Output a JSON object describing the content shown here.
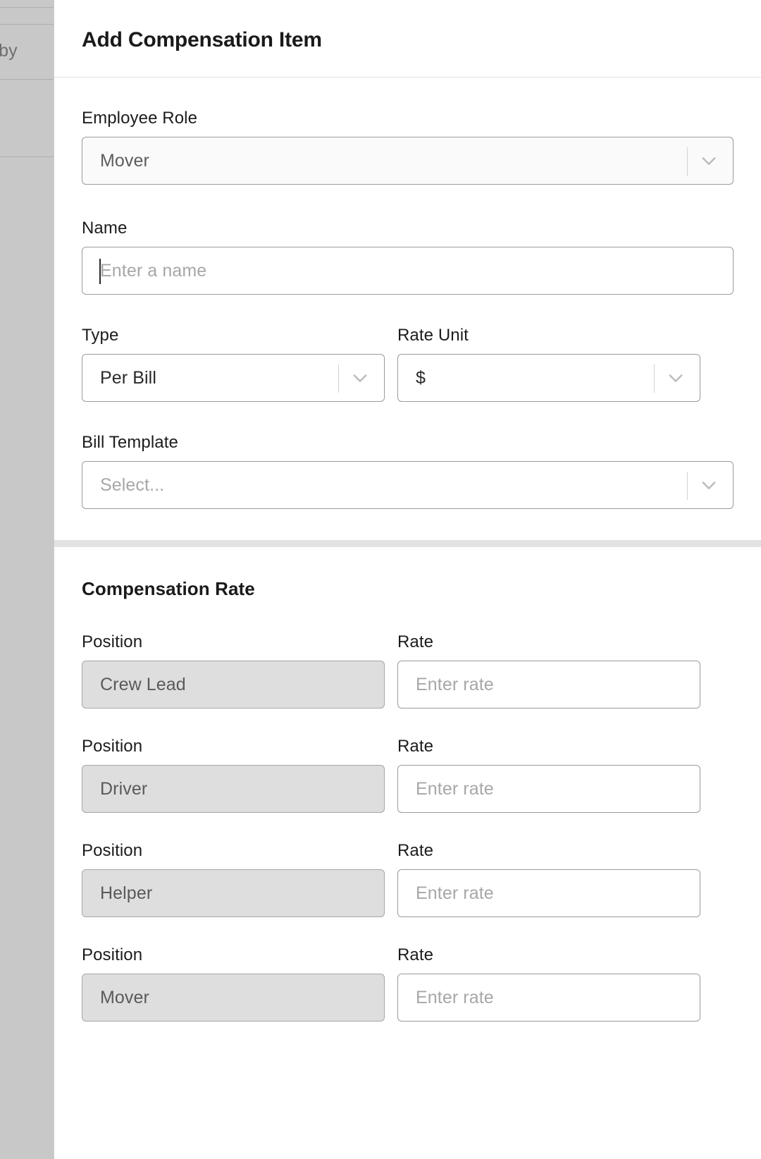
{
  "backdrop": {
    "search_fragment": "arch by"
  },
  "drawer": {
    "title": "Add Compensation Item",
    "form": {
      "employee_role": {
        "label": "Employee Role",
        "value": "Mover",
        "chevron_icon": "chevron-down-icon"
      },
      "name": {
        "label": "Name",
        "value": "",
        "placeholder": "Enter a name"
      },
      "type": {
        "label": "Type",
        "value": "Per Bill",
        "chevron_icon": "chevron-down-icon"
      },
      "rate_unit": {
        "label": "Rate Unit",
        "value": "$",
        "chevron_icon": "chevron-down-icon"
      },
      "bill_template": {
        "label": "Bill Template",
        "value": "",
        "placeholder": "Select...",
        "chevron_icon": "chevron-down-icon"
      }
    },
    "compensation_rate": {
      "heading": "Compensation Rate",
      "position_label": "Position",
      "rate_label": "Rate",
      "rate_placeholder": "Enter rate",
      "rows": [
        {
          "position": "Crew Lead",
          "rate": "",
          "position_label": "Position",
          "rate_label": "Rate",
          "rate_placeholder": "Enter rate"
        },
        {
          "position": "Driver",
          "rate": "",
          "position_label": "Position",
          "rate_label": "Rate",
          "rate_placeholder": "Enter rate"
        },
        {
          "position": "Helper",
          "rate": "",
          "position_label": "Position",
          "rate_label": "Rate",
          "rate_placeholder": "Enter rate"
        },
        {
          "position": "Mover",
          "rate": "",
          "position_label": "Position",
          "rate_label": "Rate",
          "rate_placeholder": "Enter rate"
        }
      ]
    }
  },
  "colors": {
    "panel_background": "#ffffff",
    "backdrop_scrim": "#c8c8c8",
    "text_primary": "#1a1a1a",
    "text_placeholder": "#a7a7a7",
    "border": "#9b9b9b",
    "disabled_fill": "#dedede",
    "band": "#e2e2e2"
  }
}
